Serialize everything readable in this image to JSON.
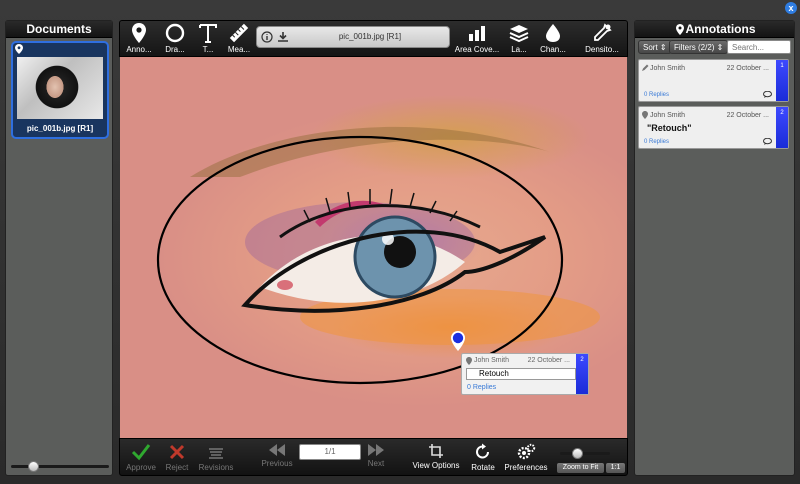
{
  "window": {
    "close_label": "x"
  },
  "documents": {
    "title": "Documents",
    "items": [
      {
        "label": "pic_001b.jpg [R1]"
      }
    ],
    "thumb_size_level": 0.2
  },
  "toolbar": {
    "tools": [
      {
        "label": "Anno...",
        "icon": "pin-icon"
      },
      {
        "label": "Dra...",
        "icon": "circle-icon"
      },
      {
        "label": "T...",
        "icon": "text-icon"
      },
      {
        "label": "Mea...",
        "icon": "ruler-icon"
      }
    ],
    "file_name": "pic_001b.jpg [R1]",
    "right_tools": [
      {
        "label": "Area Cove...",
        "icon": "bar-chart-icon"
      },
      {
        "label": "La...",
        "icon": "layers-icon"
      },
      {
        "label": "Chan...",
        "icon": "droplet-icon"
      },
      {
        "label": "Densito...",
        "icon": "eyedropper-icon"
      }
    ]
  },
  "canvas": {
    "popup": {
      "author": "John Smith",
      "date": "22 October ...",
      "edit_value": "Retouch",
      "replies": "0 Replies",
      "badge": "2"
    }
  },
  "bottombar": {
    "approve": "Approve",
    "reject": "Reject",
    "revisions": "Revisions",
    "previous": "Previous",
    "page": "1/1",
    "next": "Next",
    "view_options": "View Options",
    "rotate": "Rotate",
    "preferences": "Preferences",
    "zoom_to_fit": "Zoom to Fit",
    "zoom_one": "1:1",
    "zoom_level": 0.3
  },
  "annotations": {
    "title": "Annotations",
    "sort_label": "Sort",
    "filters_label": "Filters (2/2)",
    "search_placeholder": "Search...",
    "notes": [
      {
        "author": "John Smith",
        "date": "22 October ...",
        "replies": "0 Replies",
        "badge": "1",
        "text": "",
        "icon": "pencil-icon"
      },
      {
        "author": "John Smith",
        "date": "22 October ...",
        "replies": "0 Replies",
        "badge": "2",
        "text": "\"Retouch\"",
        "icon": "pin-icon"
      }
    ]
  },
  "colors": {
    "accent": "#2f6fe0",
    "badge": "#2a36f0",
    "approve": "#2fa82f",
    "reject": "#c0392b",
    "link": "#3a7ad6"
  }
}
